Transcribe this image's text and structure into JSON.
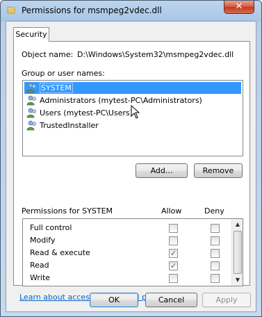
{
  "window": {
    "title": "Permissions for msmpeg2vdec.dll",
    "close_glyph": "✕"
  },
  "tabs": [
    {
      "label": "Security"
    }
  ],
  "object": {
    "label": "Object name:",
    "value": "D:\\Windows\\System32\\msmpeg2vdec.dll"
  },
  "groups": {
    "label": "Group or user names:",
    "items": [
      {
        "name": "SYSTEM",
        "selected": true
      },
      {
        "name": "Administrators (mytest-PC\\Administrators)",
        "selected": false
      },
      {
        "name": "Users (mytest-PC\\Users)",
        "selected": false
      },
      {
        "name": "TrustedInstaller",
        "selected": false
      }
    ]
  },
  "buttons": {
    "add": "Add...",
    "remove": "Remove",
    "ok": "OK",
    "cancel": "Cancel",
    "apply": "Apply"
  },
  "permissions": {
    "label": "Permissions for SYSTEM",
    "allow_header": "Allow",
    "deny_header": "Deny",
    "rows": [
      {
        "name": "Full control",
        "allow": false,
        "deny": false
      },
      {
        "name": "Modify",
        "allow": false,
        "deny": false
      },
      {
        "name": "Read & execute",
        "allow": true,
        "deny": false
      },
      {
        "name": "Read",
        "allow": true,
        "deny": false
      },
      {
        "name": "Write",
        "allow": false,
        "deny": false
      }
    ],
    "check_glyph": "✓"
  },
  "link": "Learn about access control and permissions"
}
